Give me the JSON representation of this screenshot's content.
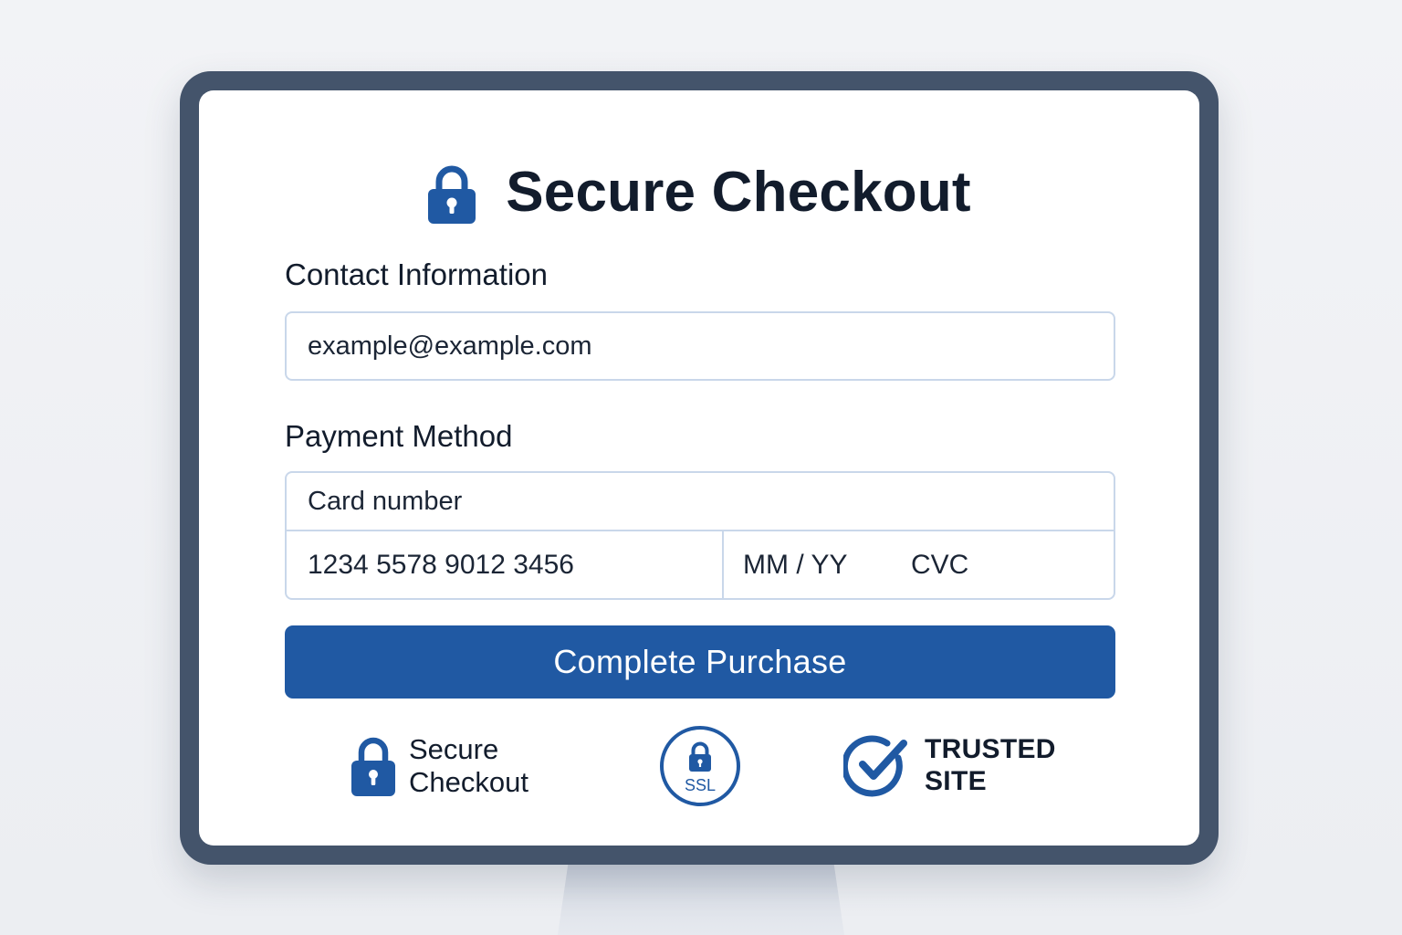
{
  "header": {
    "title": "Secure Checkout",
    "icon": "lock-icon"
  },
  "contact": {
    "label": "Contact Information",
    "email_value": "example@example.com"
  },
  "payment": {
    "label": "Payment Method",
    "card_number_label": "Card number",
    "card_number_value": "1234 5578 9012 3456",
    "expiry_placeholder": "MM / YY",
    "cvc_placeholder": "CVC"
  },
  "actions": {
    "purchase_label": "Complete Purchase"
  },
  "badges": {
    "secure_line1": "Secure",
    "secure_line2": "Checkout",
    "ssl_text": "SSL",
    "trusted_line1": "TRUSTED",
    "trusted_line2": "SITE"
  },
  "colors": {
    "accent": "#2059a3",
    "frame": "#44546b",
    "text": "#121c2c",
    "input_border": "#c9d7ea"
  }
}
